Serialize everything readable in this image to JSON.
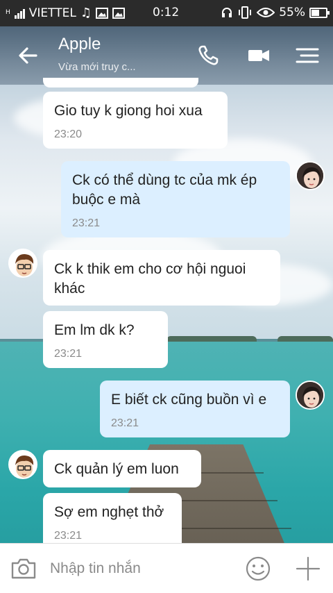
{
  "status_bar": {
    "carrier": "VIETTEL",
    "network_indicator": "H",
    "time": "0:12",
    "battery_percent": "55%",
    "battery_level": 0.55
  },
  "header": {
    "contact_name": "Apple",
    "status": "Vừa mới truy c..."
  },
  "messages": [
    {
      "direction": "in",
      "text": "Gio tuy k giong hoi xua",
      "time": "23:20"
    },
    {
      "direction": "out",
      "text": "Ck có thể dùng tc của mk ép buộc e mà",
      "time": "23:21"
    },
    {
      "direction": "in",
      "text": "Ck k thik em cho cơ hội nguoi khác",
      "time": ""
    },
    {
      "direction": "in",
      "text": "Em lm dk k?",
      "time": "23:21"
    },
    {
      "direction": "out",
      "text": "E biết ck cũng buồn vì e",
      "time": "23:21"
    },
    {
      "direction": "in",
      "text": "Ck quản lý em luon",
      "time": ""
    },
    {
      "direction": "in",
      "text": "Sợ em nghẹt thở",
      "time": "23:21"
    }
  ],
  "input": {
    "placeholder": "Nhập tin nhắn"
  },
  "icons": {
    "back": "arrow-left-icon",
    "call": "phone-icon",
    "video": "video-camera-icon",
    "menu": "menu-icon",
    "camera": "camera-icon",
    "emoji": "smiley-icon",
    "add": "plus-icon"
  },
  "colors": {
    "incoming_bubble": "#ffffff",
    "outgoing_bubble": "#dcefff",
    "status_bar": "#2b2b2b"
  }
}
